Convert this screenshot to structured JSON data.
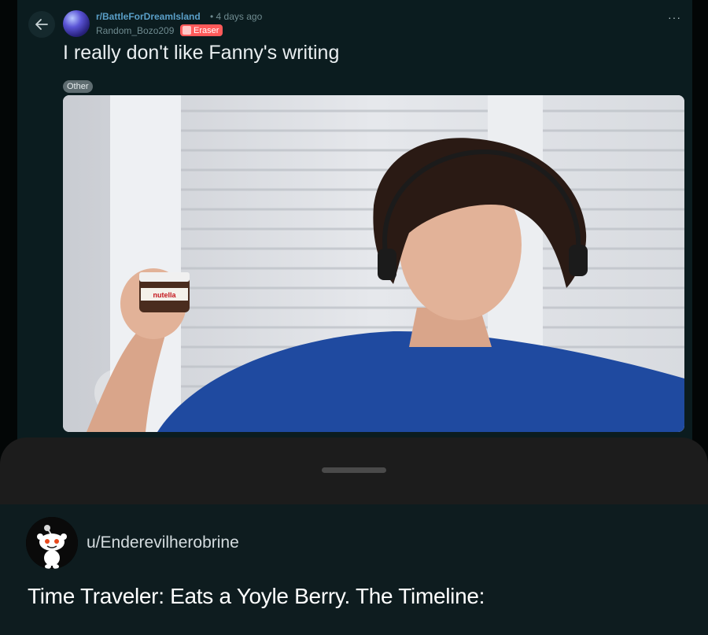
{
  "post": {
    "subreddit": "r/BattleForDreamIsland",
    "time": "• 4 days ago",
    "author": "Random_Bozo209",
    "flair": "Eraser",
    "title": "I really don't like Fanny's writing",
    "tag": "Other",
    "more_label": "···",
    "icons": {
      "back": "arrow-left-icon",
      "more": "more-dots-icon",
      "flair": "eraser-icon"
    }
  },
  "comment": {
    "username": "u/Enderevilherobrine",
    "text": "Time Traveler: Eats a Yoyle Berry. The Timeline:"
  },
  "colors": {
    "background": "#030606",
    "post_bg": "#0b1c1f",
    "subreddit": "#5a9fc8",
    "flair": "#ff5a5a",
    "sheet": "#1c1c1c",
    "comment_bg": "#0e1c1f"
  }
}
